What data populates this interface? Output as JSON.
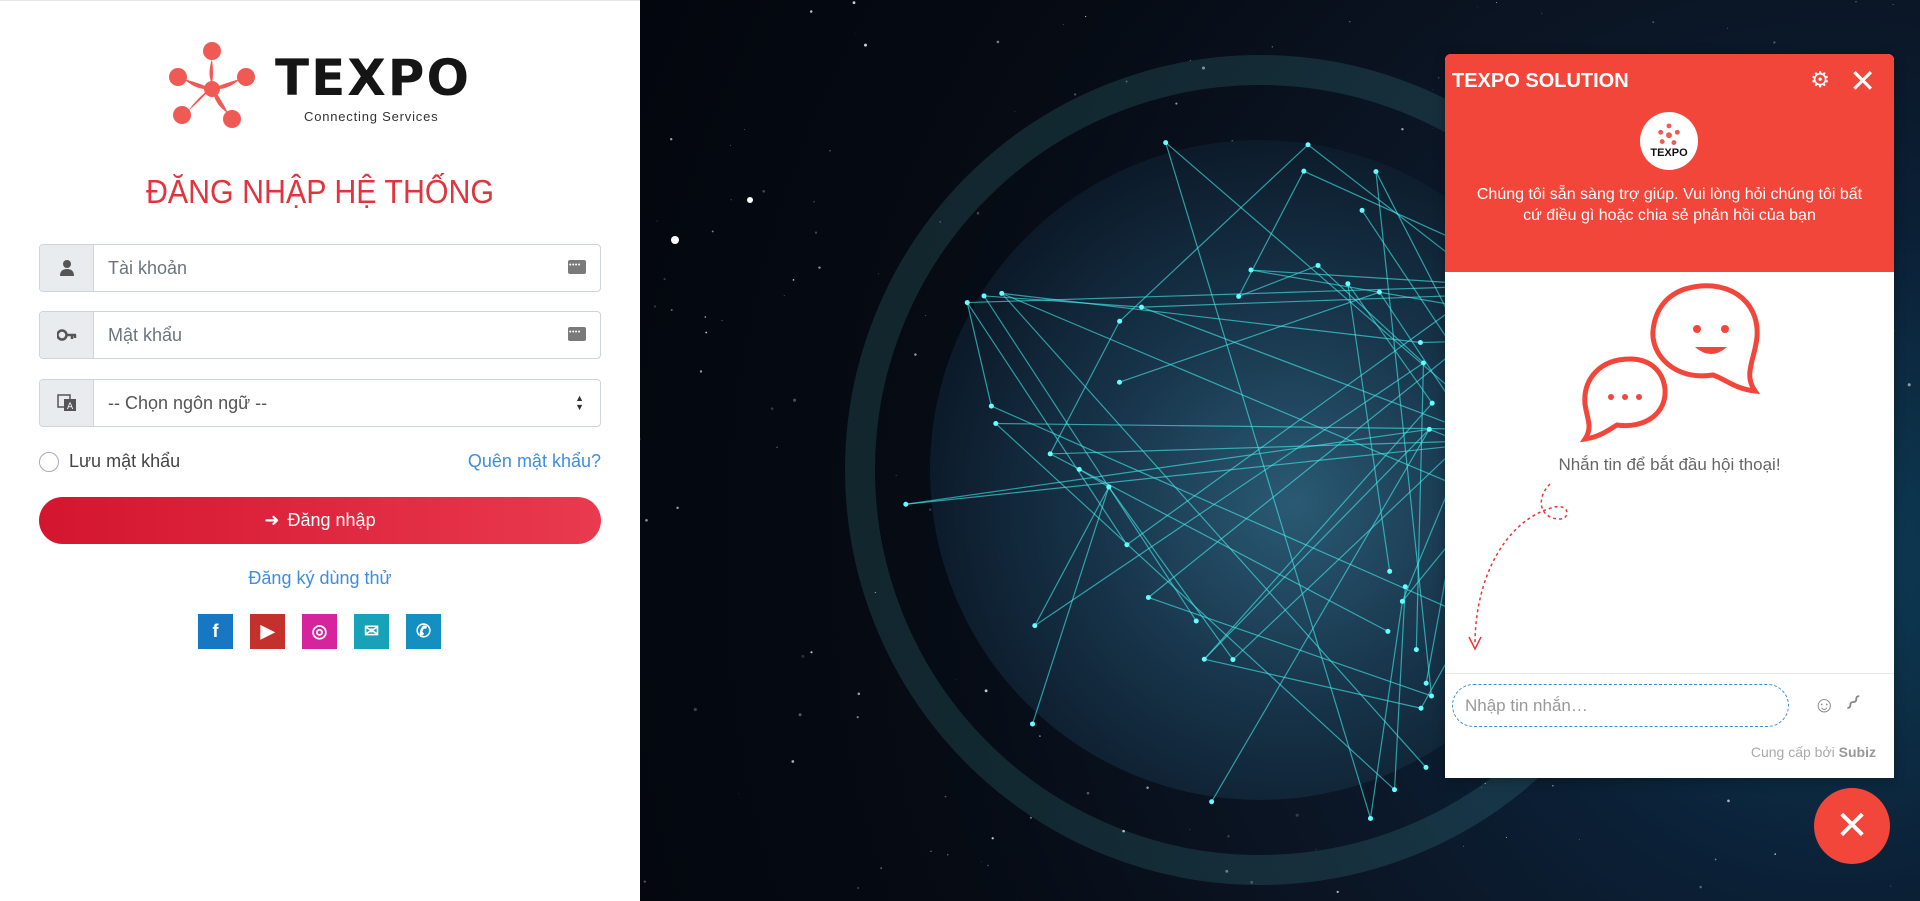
{
  "brand": {
    "name": "TEXPO",
    "tagline": "Connecting Services",
    "color": "#f05a55"
  },
  "login": {
    "title": "ĐĂNG NHẬP HỆ THỐNG",
    "username_placeholder": "Tài khoản",
    "password_placeholder": "Mật khẩu",
    "language_selected": "-- Chọn ngôn ngữ --",
    "remember_label": "Lưu mật khẩu",
    "forgot_label": "Quên mật khẩu?",
    "submit_label": "Đăng nhập",
    "register_label": "Đăng ký dùng thử"
  },
  "social": [
    {
      "name": "facebook-icon",
      "glyph": "f",
      "color": "#1877c2"
    },
    {
      "name": "youtube-icon",
      "glyph": "▶",
      "color": "#c4302b"
    },
    {
      "name": "instagram-icon",
      "glyph": "◎",
      "color": "#d6249f"
    },
    {
      "name": "email-icon",
      "glyph": "✉",
      "color": "#17a2b8"
    },
    {
      "name": "phone-icon",
      "glyph": "✆",
      "color": "#138fc2"
    }
  ],
  "chat": {
    "title": "TEXPO SOLUTION",
    "avatar_text": "TEXPO",
    "greeting": "Chúng tôi sẵn sàng trợ giúp. Vui lòng hỏi chúng tôi bất cứ điều gì hoặc chia sẻ phản hồi của bạn",
    "empty_state": "Nhắn tin để bắt đầu hội thoại!",
    "input_placeholder": "Nhập tin nhắn…",
    "powered_by": "Cung cấp bởi",
    "powered_brand": "Subiz",
    "accent": "#f2463a"
  }
}
